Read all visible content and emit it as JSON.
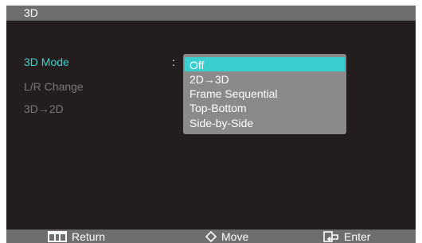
{
  "window": {
    "title": "3D"
  },
  "menu": {
    "items": [
      {
        "label": "3D Mode",
        "active": true
      },
      {
        "label": "L/R Change",
        "active": false
      },
      {
        "label": "3D→2D",
        "active": false
      }
    ],
    "separator": ":"
  },
  "dropdown": {
    "selected": "Off",
    "options": [
      {
        "label": "Off"
      },
      {
        "label": "2D→3D"
      },
      {
        "label": "Frame Sequential"
      },
      {
        "label": "Top-Bottom"
      },
      {
        "label": "Side-by-Side"
      }
    ]
  },
  "footer": {
    "hints": [
      {
        "icon": "menu-bars-icon",
        "label": "Return"
      },
      {
        "icon": "diamond-move-icon",
        "label": "Move"
      },
      {
        "icon": "enter-icon",
        "label": "Enter"
      }
    ]
  },
  "colors": {
    "background": "#231d1d",
    "bar": "#6f6d6d",
    "accent": "#39cfcf",
    "active_text": "#3fd0d0",
    "inactive_text": "#7d7676",
    "dropdown_bg": "#8c8989"
  }
}
